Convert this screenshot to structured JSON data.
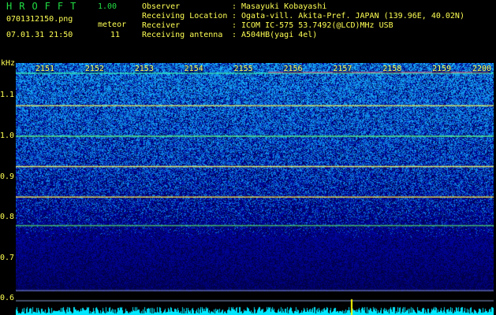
{
  "header": {
    "app_title": "HROFFT",
    "version": "1.00",
    "file_name": "0701312150.png",
    "mode_label": "meteor",
    "datetime": "07.01.31 21:50",
    "mode_count": "11",
    "info": [
      {
        "label": "Observer",
        "value": "Masayuki Kobayashi"
      },
      {
        "label": "Receiving Location",
        "value": "Ogata-vill. Akita-Pref. JAPAN (139.96E, 40.02N)"
      },
      {
        "label": "Receiver",
        "value": "ICOM IC-575 53.7492(@LCD)MHz USB"
      },
      {
        "label": "Receiving antenna",
        "value": "A504HB(yagi 4el)"
      }
    ],
    "info_separator": ":"
  },
  "chart_data": {
    "type": "heatmap",
    "ylabel": "kHz",
    "y_ticks": [
      "1.1",
      "1.0",
      "0.9",
      "0.8",
      "0.7",
      "0.6"
    ],
    "x_ticks": [
      "2151",
      "2152",
      "2153",
      "2154",
      "2155",
      "2156",
      "2157",
      "2158",
      "2159",
      "2200"
    ],
    "ylim": [
      0.56,
      1.18
    ],
    "carrier_lines": [
      {
        "freq_khz": 1.155,
        "color": "#40ffb0",
        "intensity": 0.8
      },
      {
        "freq_khz": 1.075,
        "color": "#ffff55",
        "intensity": 0.8
      },
      {
        "freq_khz": 1.0,
        "color": "#60ff80",
        "intensity": 0.9
      },
      {
        "freq_khz": 0.925,
        "color": "#ffff66",
        "intensity": 0.9
      },
      {
        "freq_khz": 0.85,
        "color": "#ffe040",
        "intensity": 0.9
      },
      {
        "freq_khz": 0.78,
        "color": "#60ff60",
        "intensity": 0.7
      }
    ],
    "reference_lines_khz": [
      0.62,
      0.595
    ],
    "colors": {
      "noise_low": "#00008a",
      "noise_high": "#3a6cff",
      "background": "#000000",
      "text": "#ffff55",
      "title": "#22dd44",
      "signal_bar": "#00e8ff",
      "meteor_spike": "#ffff00",
      "meteor_trace": "#ff5080"
    }
  }
}
